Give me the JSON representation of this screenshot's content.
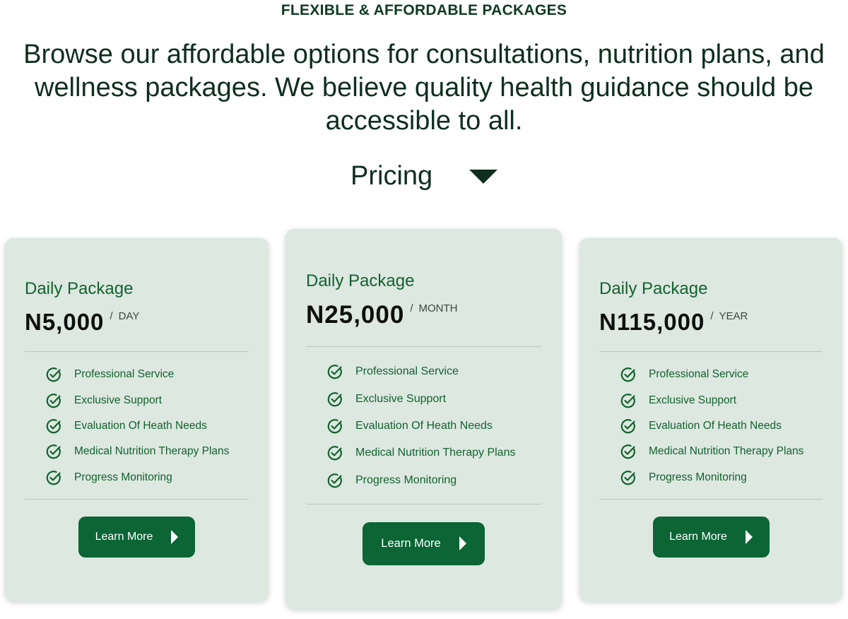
{
  "header": {
    "eyebrow": "FLEXIBLE & AFFORDABLE PACKAGES",
    "lead": "Browse our affordable options for consultations, nutrition plans, and wellness packages. We believe quality health guidance should be accessible to all.",
    "pricing_label": "Pricing"
  },
  "colors": {
    "accent": "#0b6535",
    "card_bg": "#dce8e0",
    "heading": "#0f2e1f"
  },
  "cards": [
    {
      "title": "Daily Package",
      "price": "N5,000",
      "slash": "/",
      "period": "DAY",
      "features": [
        "Professional Service",
        "Exclusive Support",
        "Evaluation Of Heath Needs",
        "Medical Nutrition Therapy Plans",
        "Progress Monitoring"
      ],
      "button": "Learn More"
    },
    {
      "title": "Daily Package",
      "price": "N25,000",
      "slash": "/",
      "period": "MONTH",
      "features": [
        "Professional Service",
        "Exclusive Support",
        "Evaluation Of Heath Needs",
        "Medical Nutrition Therapy Plans",
        "Progress Monitoring"
      ],
      "button": "Learn More"
    },
    {
      "title": "Daily Package",
      "price": "N115,000",
      "slash": "/",
      "period": "YEAR",
      "features": [
        "Professional Service",
        "Exclusive Support",
        "Evaluation Of Heath Needs",
        "Medical Nutrition Therapy Plans",
        "Progress Monitoring"
      ],
      "button": "Learn More"
    }
  ],
  "icons": {
    "feature": "check-circle-icon",
    "button": "play-arrow-icon",
    "toggle": "caret-down-icon"
  }
}
